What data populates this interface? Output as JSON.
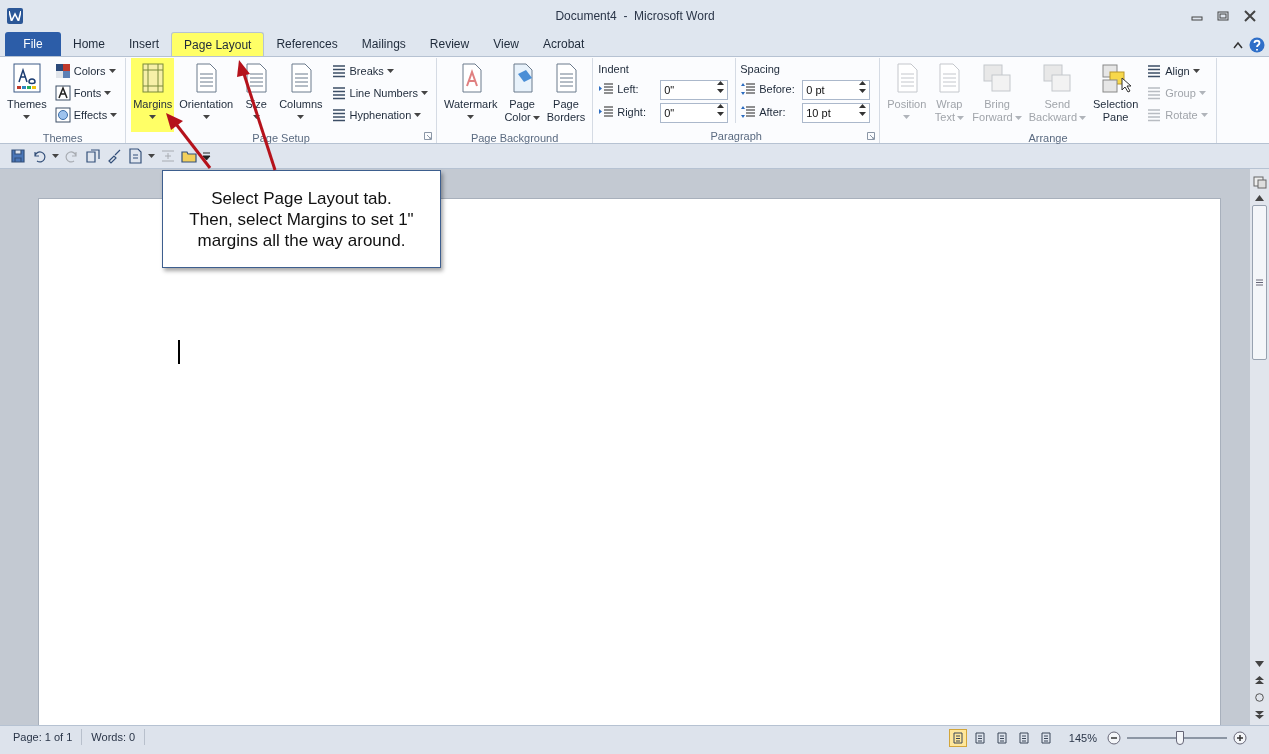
{
  "window": {
    "title": "Document4  -  Microsoft Word"
  },
  "tabs": [
    {
      "label": "File",
      "kind": "file",
      "selected": false,
      "highlighted": false
    },
    {
      "label": "Home",
      "kind": "tab",
      "selected": false,
      "highlighted": false
    },
    {
      "label": "Insert",
      "kind": "tab",
      "selected": false,
      "highlighted": false
    },
    {
      "label": "Page Layout",
      "kind": "tab",
      "selected": true,
      "highlighted": true
    },
    {
      "label": "References",
      "kind": "tab",
      "selected": false,
      "highlighted": false
    },
    {
      "label": "Mailings",
      "kind": "tab",
      "selected": false,
      "highlighted": false
    },
    {
      "label": "Review",
      "kind": "tab",
      "selected": false,
      "highlighted": false
    },
    {
      "label": "View",
      "kind": "tab",
      "selected": false,
      "highlighted": false
    },
    {
      "label": "Acrobat",
      "kind": "tab",
      "selected": false,
      "highlighted": false
    }
  ],
  "ribbon": {
    "groups": [
      {
        "kind": "buttons",
        "label": "Themes",
        "large": [
          {
            "lines": [
              "Themes"
            ],
            "dropdown": true,
            "disabled": false,
            "highlighted": false
          }
        ],
        "small": [
          {
            "label": "Colors",
            "dropdown": true,
            "disabled": false
          },
          {
            "label": "Fonts",
            "dropdown": true,
            "disabled": false
          },
          {
            "label": "Effects",
            "dropdown": true,
            "disabled": false
          }
        ],
        "launcher": false
      },
      {
        "kind": "buttons",
        "label": "Page Setup",
        "large": [
          {
            "lines": [
              "Margins"
            ],
            "dropdown": true,
            "disabled": false,
            "highlighted": true
          },
          {
            "lines": [
              "Orientation"
            ],
            "dropdown": true,
            "disabled": false,
            "highlighted": false
          },
          {
            "lines": [
              "Size"
            ],
            "dropdown": true,
            "disabled": false,
            "highlighted": false
          },
          {
            "lines": [
              "Columns"
            ],
            "dropdown": true,
            "disabled": false,
            "highlighted": false
          }
        ],
        "small": [
          {
            "label": "Breaks",
            "dropdown": true,
            "disabled": false
          },
          {
            "label": "Line Numbers",
            "dropdown": true,
            "disabled": false
          },
          {
            "label": "Hyphenation",
            "dropdown": true,
            "disabled": false
          }
        ],
        "launcher": true
      },
      {
        "kind": "buttons",
        "label": "Page Background",
        "large": [
          {
            "lines": [
              "Watermark"
            ],
            "dropdown": true,
            "disabled": false,
            "highlighted": false
          },
          {
            "lines": [
              "Page",
              "Color"
            ],
            "dropdown": true,
            "disabled": false,
            "highlighted": false
          },
          {
            "lines": [
              "Page",
              "Borders"
            ],
            "dropdown": false,
            "disabled": false,
            "highlighted": false
          }
        ],
        "launcher": false
      },
      {
        "kind": "paragraph",
        "label": "Paragraph",
        "launcher": true,
        "sections": [
          {
            "heading": "Indent",
            "fields": [
              {
                "label": "Left:",
                "value": "0\""
              },
              {
                "label": "Right:",
                "value": "0\""
              }
            ]
          },
          {
            "heading": "Spacing",
            "fields": [
              {
                "label": "Before:",
                "value": "0 pt"
              },
              {
                "label": "After:",
                "value": "10 pt"
              }
            ]
          }
        ]
      },
      {
        "kind": "buttons",
        "label": "Arrange",
        "large": [
          {
            "lines": [
              "Position"
            ],
            "dropdown": true,
            "disabled": true,
            "highlighted": false
          },
          {
            "lines": [
              "Wrap",
              "Text"
            ],
            "dropdown": true,
            "disabled": true,
            "highlighted": false
          },
          {
            "lines": [
              "Bring",
              "Forward"
            ],
            "dropdown": true,
            "disabled": true,
            "highlighted": false
          },
          {
            "lines": [
              "Send",
              "Backward"
            ],
            "dropdown": true,
            "disabled": true,
            "highlighted": false
          },
          {
            "lines": [
              "Selection",
              "Pane"
            ],
            "dropdown": false,
            "disabled": false,
            "highlighted": false
          }
        ],
        "small": [
          {
            "label": "Align",
            "dropdown": true,
            "disabled": false
          },
          {
            "label": "Group",
            "dropdown": true,
            "disabled": true
          },
          {
            "label": "Rotate",
            "dropdown": true,
            "disabled": true
          }
        ],
        "launcher": false
      }
    ]
  },
  "callout": {
    "lines": [
      "Select Page Layout tab.",
      "Then, select Margins to set 1\"",
      "margins all the way around."
    ]
  },
  "status_bar": {
    "page": "Page: 1 of 1",
    "words": "Words: 0",
    "views": [
      {
        "selected": true
      },
      {
        "selected": false
      },
      {
        "selected": false
      },
      {
        "selected": false
      },
      {
        "selected": false
      }
    ],
    "zoom": "145%",
    "zoom_slider": {
      "level": 0.53
    }
  }
}
